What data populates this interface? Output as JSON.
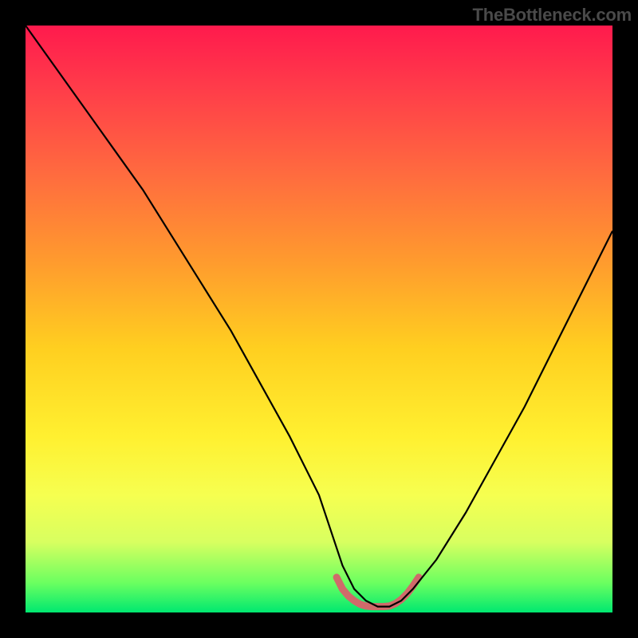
{
  "watermark": "TheBottleneck.com",
  "chart_data": {
    "type": "line",
    "title": "",
    "xlabel": "",
    "ylabel": "",
    "xlim": [
      0,
      100
    ],
    "ylim": [
      0,
      100
    ],
    "background_gradient": {
      "orientation": "vertical",
      "stops": [
        {
          "pos": 0.0,
          "color": "#ff1a4d"
        },
        {
          "pos": 0.25,
          "color": "#ff6a3f"
        },
        {
          "pos": 0.55,
          "color": "#ffcf20"
        },
        {
          "pos": 0.8,
          "color": "#f6ff50"
        },
        {
          "pos": 0.95,
          "color": "#6aff60"
        },
        {
          "pos": 1.0,
          "color": "#00e870"
        }
      ]
    },
    "series": [
      {
        "name": "bottleneck-curve",
        "color": "#000000",
        "stroke_width": 2,
        "x": [
          0,
          5,
          10,
          15,
          20,
          25,
          30,
          35,
          40,
          45,
          50,
          52,
          54,
          56,
          58,
          60,
          62,
          64,
          66,
          70,
          75,
          80,
          85,
          90,
          95,
          100
        ],
        "y": [
          100,
          93,
          86,
          79,
          72,
          64,
          56,
          48,
          39,
          30,
          20,
          14,
          8,
          4,
          2,
          1,
          1,
          2,
          4,
          9,
          17,
          26,
          35,
          45,
          55,
          65
        ]
      },
      {
        "name": "optimal-band",
        "color": "#d06a6a",
        "stroke_width": 7,
        "x": [
          53,
          54,
          55,
          56,
          57,
          58,
          59,
          60,
          61,
          62,
          63,
          64,
          65,
          66,
          67
        ],
        "y": [
          6.0,
          4.0,
          2.8,
          2.0,
          1.4,
          1.1,
          1.0,
          1.0,
          1.0,
          1.1,
          1.5,
          2.2,
          3.2,
          4.5,
          6.0
        ]
      }
    ],
    "annotations": []
  }
}
